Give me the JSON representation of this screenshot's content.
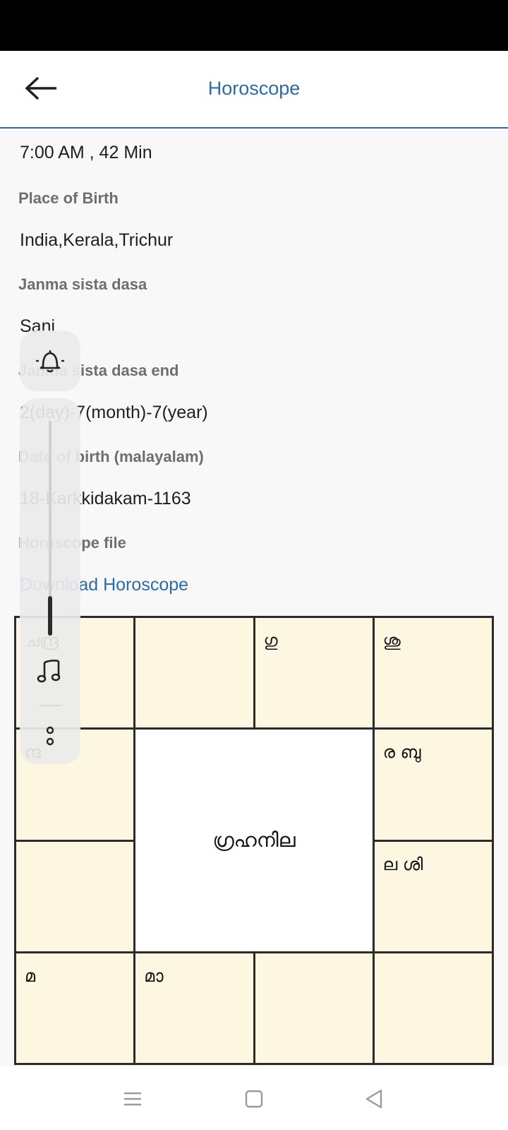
{
  "app_bar": {
    "title": "Horoscope"
  },
  "details": {
    "time_value": "7:00 AM , 42 Min",
    "place_label": "Place of Birth",
    "place_value": "India,Kerala,Trichur",
    "dasa_label": "Janma sista dasa",
    "dasa_value": "Sani",
    "dasa_end_label": "Janma sista dasa end",
    "dasa_end_value": "2(day)-7(month)-7(year)",
    "dob_mal_label": "Date of birth (malayalam)",
    "dob_mal_value": "18-Karkkidakam-1163",
    "file_label": "Horoscope file",
    "download_link": "Download Horoscope"
  },
  "chart": {
    "center_label": "ഗ്രഹനില",
    "cells": {
      "r1c1": "ചന്ദ്ര",
      "r1c2": "",
      "r1c3": "ഗു",
      "r1c4": "ശു",
      "r2c1": "ന്ദ",
      "r2c4": "ര ബു",
      "r3c1": "",
      "r3c4": "ല ശി",
      "r4c1": "മ",
      "r4c2": "മാ",
      "r4c3": "",
      "r4c4": ""
    }
  },
  "volume_panel": {
    "level_fraction": 0.2
  },
  "colors": {
    "accent": "#2a6ba8",
    "chart_cell": "#fdf7e1",
    "chart_border": "#2b2b2b"
  },
  "icons": [
    "back-arrow-icon",
    "bell-icon",
    "music-note-icon",
    "more-vert-icon",
    "menu-icon",
    "home-icon",
    "back-icon"
  ]
}
